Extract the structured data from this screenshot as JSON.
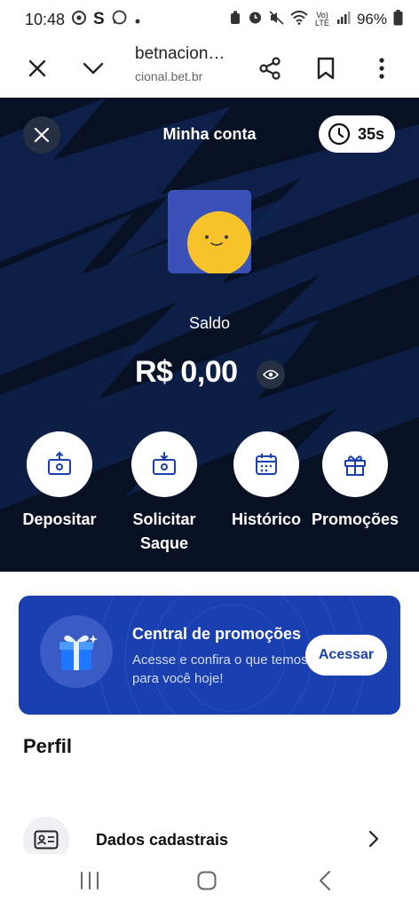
{
  "status_bar": {
    "time": "10:48",
    "battery": "96%",
    "icons_left": [
      "chrome-icon",
      "s-app-icon",
      "whatsapp-icon",
      "dot-icon"
    ],
    "icons_right": [
      "alarm-icon",
      "clock-icon",
      "mute-icon",
      "wifi-icon",
      "volte-icon",
      "signal-icon",
      "battery-icon"
    ],
    "volte_text": "Vo) LTE"
  },
  "browser": {
    "title": "betnacion…",
    "url": "cional.bet.br"
  },
  "hero": {
    "title": "Minha conta",
    "timer": "35s",
    "saldo_label": "Saldo",
    "balance": "R$ 0,00",
    "actions": [
      {
        "label": "Depositar",
        "icon": "deposit-icon"
      },
      {
        "label": "Solicitar Saque",
        "icon": "withdraw-icon"
      },
      {
        "label": "Histórico",
        "icon": "calendar-icon"
      },
      {
        "label": "Promoções",
        "icon": "gift-icon"
      }
    ]
  },
  "promo": {
    "title": "Central de promoções",
    "description": "Acesse e confira o que temos para você hoje!",
    "button": "Acessar"
  },
  "profile": {
    "heading": "Perfil",
    "items": [
      {
        "label": "Dados cadastrais",
        "icon": "id-card-icon"
      }
    ]
  },
  "colors": {
    "hero_bg": "#081024",
    "brand_blue": "#1a3fb0",
    "avatar_bg": "#3a52b8",
    "avatar_face": "#f7c22a"
  }
}
